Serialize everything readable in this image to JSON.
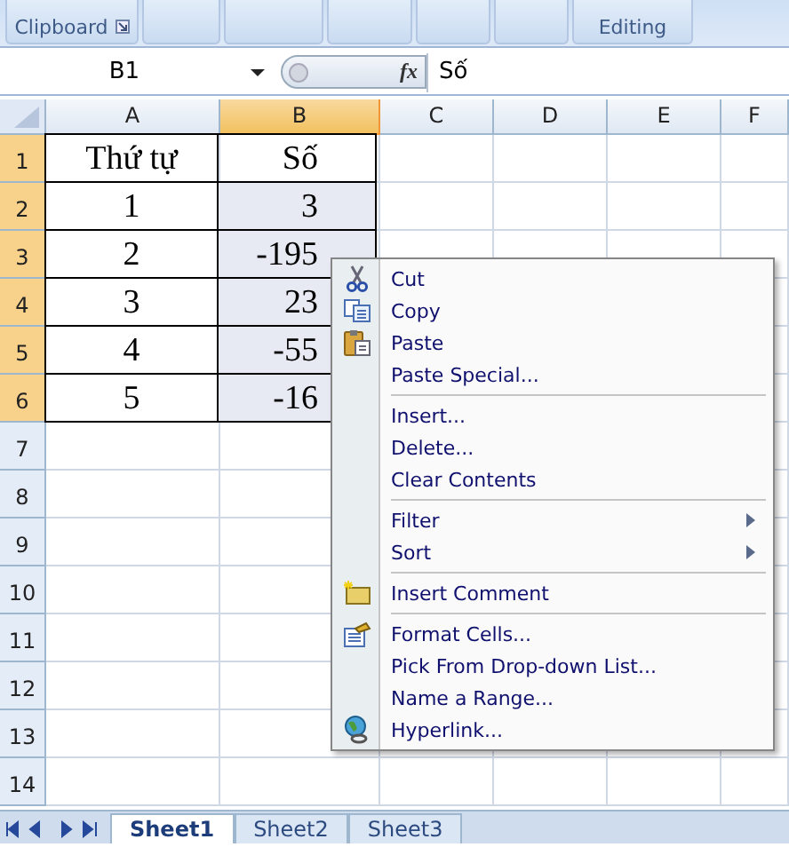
{
  "ribbon": {
    "groups": [
      {
        "kind": "labeled",
        "label": "Clipboard"
      },
      {
        "kind": "blank"
      },
      {
        "kind": "blank"
      },
      {
        "kind": "blank"
      },
      {
        "kind": "blank"
      },
      {
        "kind": "blank"
      },
      {
        "kind": "labeled",
        "label": "Editing"
      }
    ]
  },
  "formula_bar": {
    "name_box": "B1",
    "function_button": "fx",
    "value": "Số"
  },
  "columns": [
    {
      "label": "A",
      "selected": false
    },
    {
      "label": "B",
      "selected": true
    },
    {
      "label": "C",
      "selected": false
    },
    {
      "label": "D",
      "selected": false
    },
    {
      "label": "E",
      "selected": false
    },
    {
      "label": "F",
      "selected": false
    }
  ],
  "rows": [
    {
      "header": "1",
      "selected": true,
      "cells": [
        "Thứ tự",
        "Số"
      ]
    },
    {
      "header": "2",
      "selected": true,
      "cells": [
        "1",
        "3"
      ]
    },
    {
      "header": "3",
      "selected": true,
      "cells": [
        "2",
        "-195"
      ]
    },
    {
      "header": "4",
      "selected": true,
      "cells": [
        "3",
        "23"
      ]
    },
    {
      "header": "5",
      "selected": true,
      "cells": [
        "4",
        "-55"
      ]
    },
    {
      "header": "6",
      "selected": true,
      "cells": [
        "5",
        "-16"
      ]
    },
    {
      "header": "7",
      "selected": false
    },
    {
      "header": "8",
      "selected": false
    },
    {
      "header": "9",
      "selected": false
    },
    {
      "header": "10",
      "selected": false
    },
    {
      "header": "11",
      "selected": false
    },
    {
      "header": "12",
      "selected": false
    },
    {
      "header": "13",
      "selected": false
    },
    {
      "header": "14",
      "selected": false
    }
  ],
  "context_menu": {
    "items": [
      {
        "kind": "item",
        "label": "Cut"
      },
      {
        "kind": "item",
        "label": "Copy"
      },
      {
        "kind": "item",
        "label": "Paste"
      },
      {
        "kind": "item",
        "label": "Paste Special..."
      },
      {
        "kind": "separator"
      },
      {
        "kind": "item",
        "label": "Insert..."
      },
      {
        "kind": "item",
        "label": "Delete..."
      },
      {
        "kind": "item",
        "label": "Clear Contents"
      },
      {
        "kind": "separator"
      },
      {
        "kind": "submenu",
        "label": "Filter"
      },
      {
        "kind": "submenu",
        "label": "Sort"
      },
      {
        "kind": "separator"
      },
      {
        "kind": "item",
        "label": "Insert Comment"
      },
      {
        "kind": "separator"
      },
      {
        "kind": "item",
        "label": "Format Cells..."
      },
      {
        "kind": "item",
        "label": "Pick From Drop-down List..."
      },
      {
        "kind": "item",
        "label": "Name a Range..."
      },
      {
        "kind": "item",
        "label": "Hyperlink..."
      }
    ]
  },
  "sheet_tabs": [
    {
      "label": "Sheet1",
      "selected": true
    },
    {
      "label": "Sheet2",
      "selected": false
    },
    {
      "label": "Sheet3",
      "selected": false
    }
  ]
}
